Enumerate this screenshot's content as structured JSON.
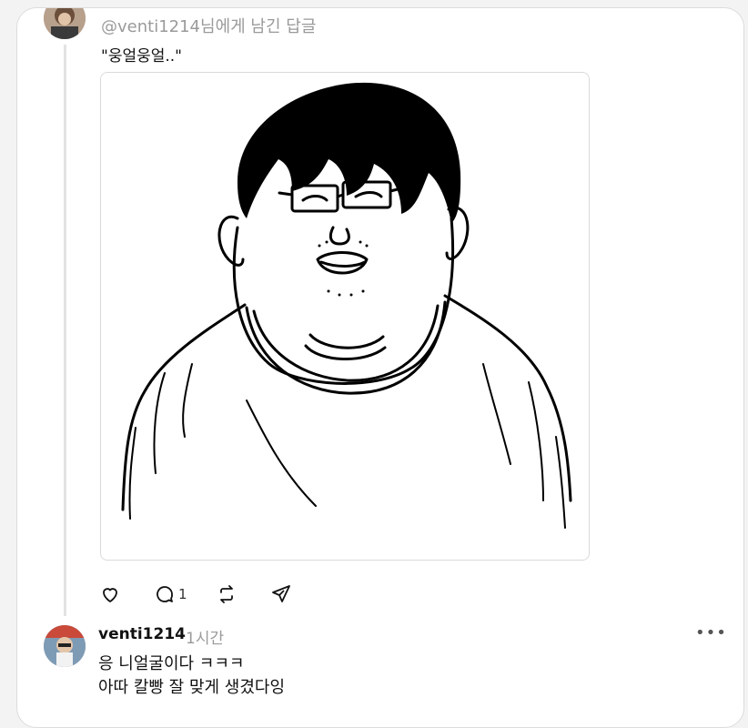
{
  "parent_post": {
    "reply_to_handle": "@venti1214",
    "reply_to_suffix": "님에게 남긴 답글",
    "text": "\"웅얼웅얼..\"",
    "reply_count": "1"
  },
  "reply": {
    "author": "venti1214",
    "time": "1시간",
    "line1": "응 니얼굴이다 ㅋㅋㅋ",
    "line2": "아따 칼빵 잘 맞게 생겼다잉",
    "more": "•••"
  },
  "icons": {
    "like": "heart-icon",
    "comment": "comment-icon",
    "repost": "repost-icon",
    "share": "send-icon",
    "more": "more-icon"
  }
}
